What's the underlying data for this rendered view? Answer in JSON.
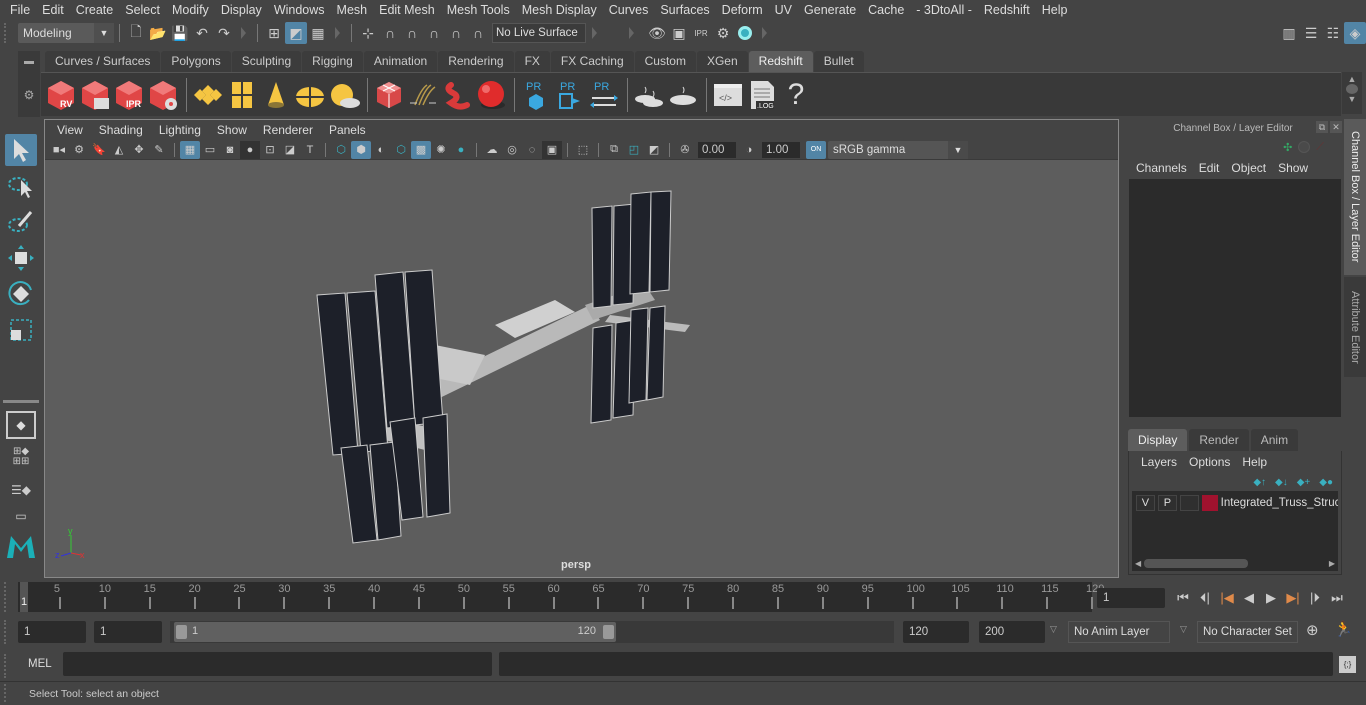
{
  "menubar": [
    "File",
    "Edit",
    "Create",
    "Select",
    "Modify",
    "Display",
    "Windows",
    "Mesh",
    "Edit Mesh",
    "Mesh Tools",
    "Mesh Display",
    "Curves",
    "Surfaces",
    "Deform",
    "UV",
    "Generate",
    "Cache",
    "- 3DtoAll -",
    "Redshift",
    "Help"
  ],
  "status_line": {
    "mode": "Modeling",
    "live_surface": "No Live Surface"
  },
  "shelf": {
    "tabs": [
      "Curves / Surfaces",
      "Polygons",
      "Sculpting",
      "Rigging",
      "Animation",
      "Rendering",
      "FX",
      "FX Caching",
      "Custom",
      "XGen",
      "Redshift",
      "Bullet"
    ],
    "active_tab": "Redshift",
    "icon_labels": {
      "rv": "RV",
      "ipr": "IPR",
      "pr": "PR",
      "log": ".LOG",
      "help": "?"
    }
  },
  "viewport": {
    "menu": [
      "View",
      "Shading",
      "Lighting",
      "Show",
      "Renderer",
      "Panels"
    ],
    "exposure": "0.00",
    "gamma": "1.00",
    "color_space": "sRGB gamma",
    "camera_label": "persp",
    "axis": {
      "x": "x",
      "y": "y",
      "z": "z"
    }
  },
  "channel_box": {
    "title": "Channel Box / Layer Editor",
    "menu": [
      "Channels",
      "Edit",
      "Object",
      "Show"
    ]
  },
  "layer_editor": {
    "tabs": [
      "Display",
      "Render",
      "Anim"
    ],
    "active_tab": "Display",
    "menu": [
      "Layers",
      "Options",
      "Help"
    ],
    "layers": [
      {
        "v": "V",
        "p": "P",
        "color": "#a0122e",
        "name": "Integrated_Truss_Struc"
      }
    ]
  },
  "side_tabs": [
    "Channel Box / Layer Editor",
    "Attribute Editor"
  ],
  "timeline": {
    "ticks": [
      5,
      10,
      15,
      20,
      25,
      30,
      35,
      40,
      45,
      50,
      55,
      60,
      65,
      70,
      75,
      80,
      85,
      90,
      95,
      100,
      105,
      110,
      115,
      120
    ],
    "current_frame_marker": "1",
    "current_frame": "1",
    "start": 1,
    "end": 120
  },
  "range": {
    "start_time": "1",
    "playback_start": "1",
    "range_start_label": "1",
    "range_end_label": "120",
    "playback_end": "120",
    "end_time": "200",
    "anim_layer": "No Anim Layer",
    "character_set": "No Character Set"
  },
  "command_line": {
    "language": "MEL",
    "input": "",
    "output": ""
  },
  "help_line": "Select Tool: select an object"
}
